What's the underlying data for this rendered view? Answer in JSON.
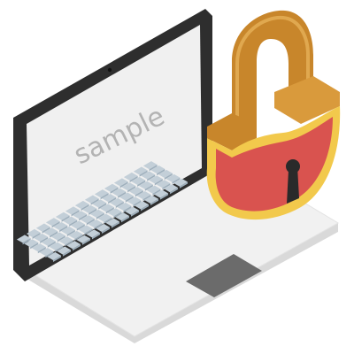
{
  "illustration": {
    "screen_text": "sample",
    "colors": {
      "laptop_body": "#f1f1f1",
      "laptop_edge": "#d9d9d9",
      "bezel": "#2e2e2e",
      "screen": "#f0f0f0",
      "screen_text": "#b3b3b3",
      "key": "#c3cfd8",
      "key_shadow": "#9fb0bd",
      "touchpad": "#6b6b6b",
      "lock_body": "#d9534f",
      "lock_rim": "#f2c94c",
      "lock_shackle": "#c8862b",
      "lock_shackle_light": "#e0a84f",
      "keyhole": "#2a2a2a"
    },
    "icons": [
      "laptop-icon",
      "padlock-icon",
      "keyhole-icon"
    ]
  }
}
